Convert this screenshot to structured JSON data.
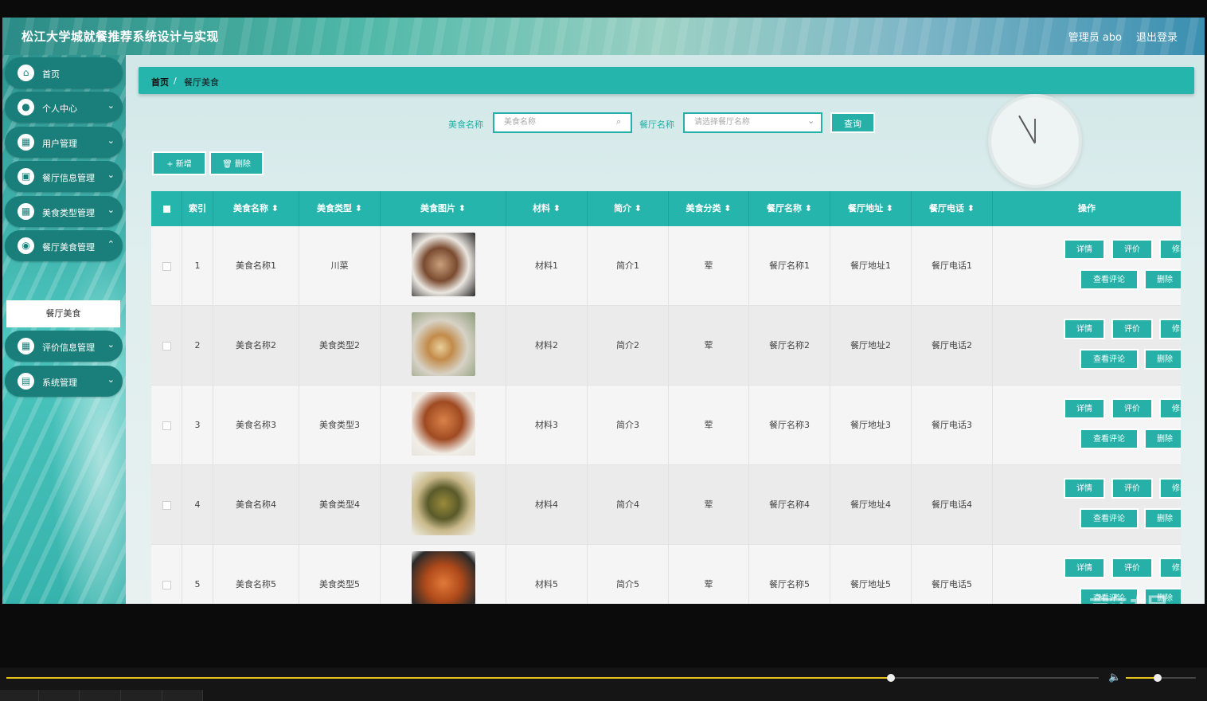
{
  "app": {
    "title": "松江大学城就餐推荐系统设计与实现",
    "user": "管理员 abo",
    "logout": "退出登录"
  },
  "sidebar": {
    "items": [
      {
        "label": "首页"
      },
      {
        "label": "个人中心"
      },
      {
        "label": "用户管理"
      },
      {
        "label": "餐厅信息管理"
      },
      {
        "label": "美食类型管理"
      },
      {
        "label": "餐厅美食管理"
      },
      {
        "label": "评价信息管理"
      },
      {
        "label": "系统管理"
      }
    ],
    "submenu": {
      "label": "餐厅美食"
    }
  },
  "breadcrumb": {
    "home": "首页",
    "sep": "/",
    "current": "餐厅美食"
  },
  "search": {
    "food_label": "美食名称",
    "food_placeholder": "美食名称",
    "restaurant_label": "餐厅名称",
    "restaurant_placeholder": "请选择餐厅名称",
    "query_button": "查询"
  },
  "toolbar": {
    "add": "+ 新增",
    "delete": "🗑 删除"
  },
  "table": {
    "headers": [
      "索引",
      "美食名称",
      "美食类型",
      "美食图片",
      "材料",
      "简介",
      "美食分类",
      "餐厅名称",
      "餐厅地址",
      "餐厅电话",
      "操作"
    ],
    "rows": [
      {
        "index": "1",
        "name": "美食名称1",
        "type": "川菜",
        "material": "材料1",
        "intro": "简介1",
        "category": "荤",
        "rname": "餐厅名称1",
        "addr": "餐厅地址1",
        "phone": "餐厅电话1"
      },
      {
        "index": "2",
        "name": "美食名称2",
        "type": "美食类型2",
        "material": "材料2",
        "intro": "简介2",
        "category": "荤",
        "rname": "餐厅名称2",
        "addr": "餐厅地址2",
        "phone": "餐厅电话2"
      },
      {
        "index": "3",
        "name": "美食名称3",
        "type": "美食类型3",
        "material": "材料3",
        "intro": "简介3",
        "category": "荤",
        "rname": "餐厅名称3",
        "addr": "餐厅地址3",
        "phone": "餐厅电话3"
      },
      {
        "index": "4",
        "name": "美食名称4",
        "type": "美食类型4",
        "material": "材料4",
        "intro": "简介4",
        "category": "荤",
        "rname": "餐厅名称4",
        "addr": "餐厅地址4",
        "phone": "餐厅电话4"
      },
      {
        "index": "5",
        "name": "美食名称5",
        "type": "美食类型5",
        "material": "材料5",
        "intro": "简介5",
        "category": "荤",
        "rname": "餐厅名称5",
        "addr": "餐厅地址5",
        "phone": "餐厅电话5"
      }
    ],
    "actions": {
      "detail": "详情",
      "rate": "评价",
      "edit": "修改",
      "comments": "查看评论",
      "delete": "删除"
    }
  },
  "player": {
    "progress": 0.81,
    "volume": 0.45
  },
  "watermark": "ev剪辑"
}
